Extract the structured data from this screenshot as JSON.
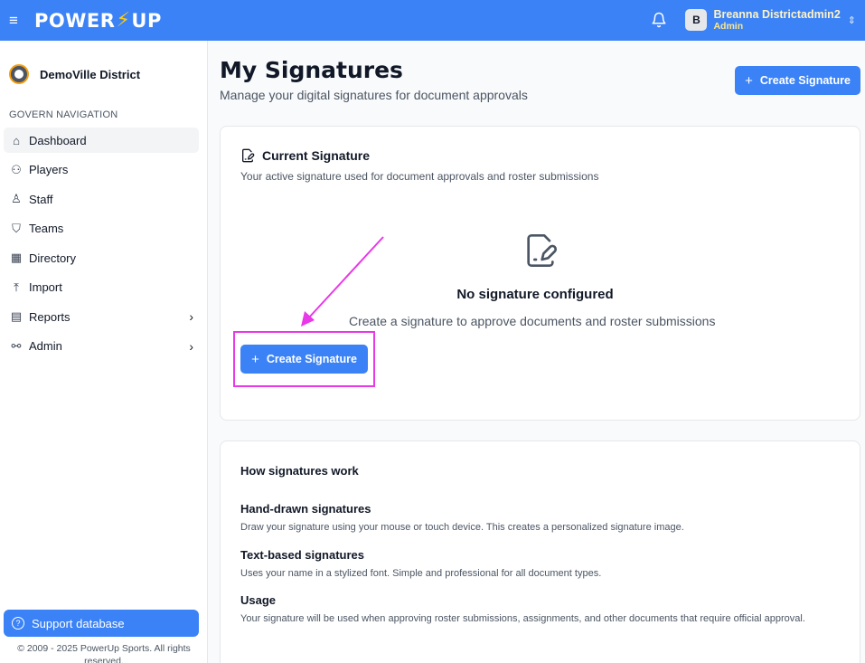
{
  "header": {
    "logo_left": "POWER",
    "logo_bolt": "⚡",
    "logo_right": "UP",
    "avatar_initial": "B",
    "user_name": "Breanna Districtadmin2",
    "user_role": "Admin"
  },
  "sidebar": {
    "district_name": "DemoVille District",
    "nav_title": "GOVERN NAVIGATION",
    "items": [
      {
        "label": "Dashboard"
      },
      {
        "label": "Players"
      },
      {
        "label": "Staff"
      },
      {
        "label": "Teams"
      },
      {
        "label": "Directory"
      },
      {
        "label": "Import"
      },
      {
        "label": "Reports"
      },
      {
        "label": "Admin"
      }
    ],
    "support_label": "Support database",
    "copyright": "© 2009 - 2025 PowerUp Sports. All rights reserved."
  },
  "main": {
    "title": "My Signatures",
    "subtitle": "Manage your digital signatures for document approvals",
    "create_button_label": "Create Signature",
    "current": {
      "title": "Current Signature",
      "description": "Your active signature used for document approvals and roster submissions",
      "empty_title": "No signature configured",
      "empty_desc": "Create a signature to approve documents and roster submissions",
      "create_button_label": "Create Signature"
    },
    "how": {
      "title": "How signatures work",
      "items": [
        {
          "title": "Hand-drawn signatures",
          "desc": "Draw your signature using your mouse or touch device. This creates a personalized signature image."
        },
        {
          "title": "Text-based signatures",
          "desc": "Uses your name in a stylized font. Simple and professional for all document types."
        },
        {
          "title": "Usage",
          "desc": "Your signature will be used when approving roster submissions, assignments, and other documents that require official approval."
        }
      ]
    }
  },
  "colors": {
    "primary": "#3b82f6",
    "annotation": "#e838e8",
    "bolt": "#facc15"
  }
}
